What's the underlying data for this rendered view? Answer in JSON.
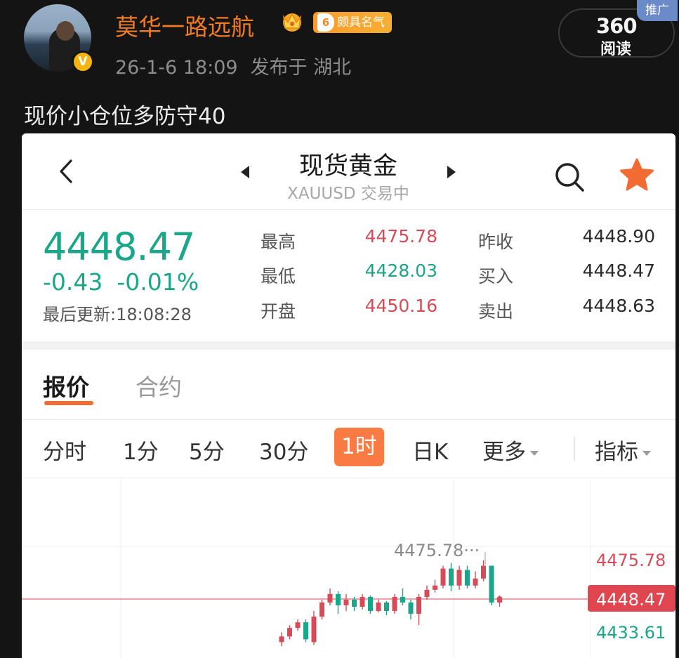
{
  "post": {
    "username": "莫华一路远航",
    "level_num": "6",
    "level_label": "颇具名气",
    "verified_badge": "V",
    "timestamp": "26-1-6 18:09",
    "location": "发布于 湖北",
    "text": "现价小仓位多防守40",
    "promo_brand": "360",
    "promo_action": "阅读",
    "promo_tag": "推广"
  },
  "quote": {
    "title": "现货黄金",
    "subtitle": "XAUUSD 交易中",
    "price": "4448.47",
    "change": "-0.43",
    "change_pct": "-0.01%",
    "updated": "最后更新:18:08:28",
    "stats": [
      {
        "label": "最高",
        "value": "4475.78",
        "color": "#d64b57"
      },
      {
        "label": "最低",
        "value": "4428.03",
        "color": "#1aa688"
      },
      {
        "label": "开盘",
        "value": "4450.16",
        "color": "#d64b57"
      },
      {
        "label": "昨收",
        "value": "4448.90",
        "color": "#2a2a2a"
      },
      {
        "label": "买入",
        "value": "4448.47",
        "color": "#2a2a2a"
      },
      {
        "label": "卖出",
        "value": "4448.63",
        "color": "#2a2a2a"
      }
    ],
    "tabs": [
      "报价",
      "合约"
    ],
    "periods": [
      "分时",
      "1分",
      "5分",
      "30分",
      "1时",
      "日K",
      "更多",
      "指标"
    ],
    "active_period": "1时",
    "colors": {
      "up": "#d64b57",
      "down": "#1aa688",
      "accent": "#fa7a43"
    }
  },
  "chart_data": {
    "type": "candlestick",
    "series": [
      {
        "values": [
          {
            "o": 4418,
            "c": 4422,
            "h": 4425,
            "l": 4415
          },
          {
            "o": 4422,
            "c": 4428,
            "h": 4430,
            "l": 4420
          },
          {
            "o": 4428,
            "c": 4432,
            "h": 4434,
            "l": 4426
          },
          {
            "o": 4432,
            "c": 4420,
            "h": 4434,
            "l": 4418
          },
          {
            "o": 4418,
            "c": 4436,
            "h": 4440,
            "l": 4416
          },
          {
            "o": 4436,
            "c": 4446,
            "h": 4448,
            "l": 4434
          },
          {
            "o": 4446,
            "c": 4452,
            "h": 4456,
            "l": 4444
          },
          {
            "o": 4452,
            "c": 4444,
            "h": 4454,
            "l": 4438
          },
          {
            "o": 4444,
            "c": 4448,
            "h": 4452,
            "l": 4440
          },
          {
            "o": 4448,
            "c": 4443,
            "h": 4450,
            "l": 4440
          },
          {
            "o": 4443,
            "c": 4450,
            "h": 4452,
            "l": 4441
          },
          {
            "o": 4450,
            "c": 4440,
            "h": 4451,
            "l": 4438
          },
          {
            "o": 4440,
            "c": 4446,
            "h": 4448,
            "l": 4439
          },
          {
            "o": 4446,
            "c": 4440,
            "h": 4447,
            "l": 4437
          },
          {
            "o": 4440,
            "c": 4450,
            "h": 4452,
            "l": 4438
          },
          {
            "o": 4450,
            "c": 4446,
            "h": 4456,
            "l": 4444
          },
          {
            "o": 4446,
            "c": 4438,
            "h": 4448,
            "l": 4434
          },
          {
            "o": 4438,
            "c": 4450,
            "h": 4452,
            "l": 4430
          },
          {
            "o": 4450,
            "c": 4455,
            "h": 4458,
            "l": 4448
          },
          {
            "o": 4455,
            "c": 4458,
            "h": 4462,
            "l": 4453
          },
          {
            "o": 4458,
            "c": 4470,
            "h": 4472,
            "l": 4456
          },
          {
            "o": 4470,
            "c": 4458,
            "h": 4474,
            "l": 4454
          },
          {
            "o": 4458,
            "c": 4469,
            "h": 4472,
            "l": 4455
          },
          {
            "o": 4469,
            "c": 4458,
            "h": 4472,
            "l": 4456
          },
          {
            "o": 4458,
            "c": 4463,
            "h": 4468,
            "l": 4456
          },
          {
            "o": 4463,
            "c": 4472,
            "h": 4475.78,
            "l": 4461
          },
          {
            "o": 4472,
            "c": 4446,
            "h": 4472,
            "l": 4444
          },
          {
            "o": 4446,
            "c": 4448.47,
            "h": 4451,
            "l": 4443
          }
        ]
      }
    ],
    "annotations": [
      "4475.78",
      "4475.78",
      "4448.47",
      "4433.61"
    ]
  }
}
